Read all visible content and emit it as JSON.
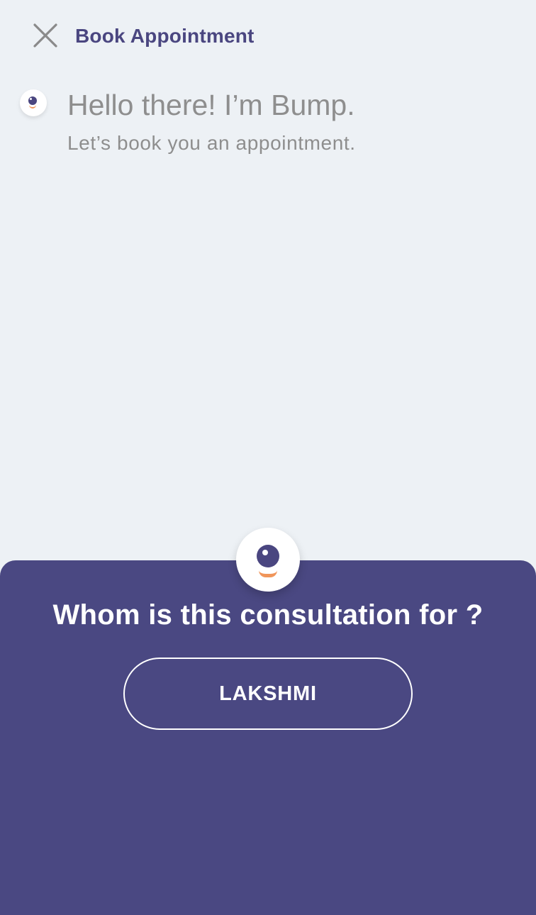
{
  "header": {
    "close_icon": "close-icon",
    "title": "Book Appointment"
  },
  "greeting": {
    "avatar_icon": "bump-mascot-icon",
    "title": "Hello there! I’m Bump.",
    "subtitle": "Let’s book you an appointment."
  },
  "sheet": {
    "avatar_icon": "bump-mascot-icon",
    "question": "Whom is this consultation for ?",
    "options": [
      {
        "label": "LAKSHMI"
      }
    ]
  },
  "colors": {
    "background": "#edf1f5",
    "brand_purple": "#4a4882",
    "title_purple": "#4a4680",
    "greeting_text": "#8e8e8e",
    "accent_orange": "#f0955a"
  }
}
